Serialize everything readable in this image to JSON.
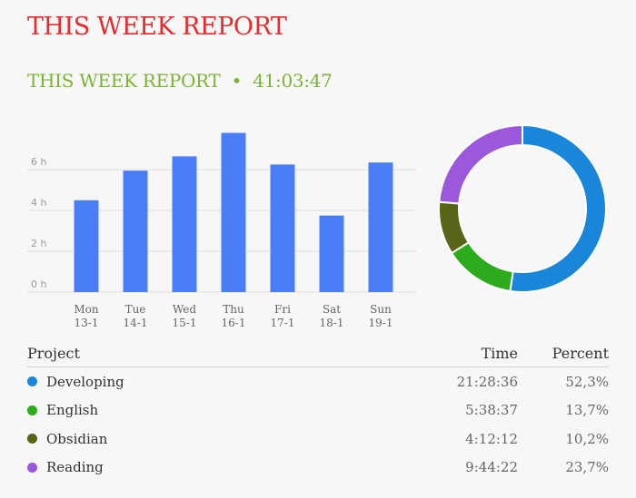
{
  "page_title": "THIS WEEK REPORT",
  "report": {
    "heading": "THIS WEEK REPORT",
    "separator": "•",
    "total": "41:03:47"
  },
  "colors": {
    "title": "#e52b2b",
    "heading": "#7ab335",
    "bar": "#4a7df7"
  },
  "chart_data": [
    {
      "type": "bar",
      "categories": [
        "Mon",
        "Tue",
        "Wed",
        "Thu",
        "Fri",
        "Sat",
        "Sun"
      ],
      "dates": [
        "13-1",
        "14-1",
        "15-1",
        "16-1",
        "17-1",
        "18-1",
        "19-1"
      ],
      "values": [
        4.5,
        5.95,
        6.65,
        7.8,
        6.25,
        3.75,
        6.35
      ],
      "yunit": "h",
      "yticks": [
        0,
        2,
        4,
        6
      ],
      "ylim": [
        0,
        8
      ],
      "grid": true
    },
    {
      "type": "pie",
      "donut": true,
      "labels": [
        "Developing",
        "English",
        "Obsidian",
        "Reading"
      ],
      "values": [
        52.3,
        13.7,
        10.2,
        23.7
      ],
      "colors": [
        "#1a86d9",
        "#2eaa1d",
        "#5a6419",
        "#9b58db"
      ]
    }
  ],
  "table": {
    "headers": {
      "project": "Project",
      "time": "Time",
      "percent": "Percent"
    },
    "rows": [
      {
        "project": "Developing",
        "time": "21:28:36",
        "percent": "52,3%",
        "color": "#1a86d9"
      },
      {
        "project": "English",
        "time": "5:38:37",
        "percent": "13,7%",
        "color": "#2eaa1d"
      },
      {
        "project": "Obsidian",
        "time": "4:12:12",
        "percent": "10,2%",
        "color": "#5a6419"
      },
      {
        "project": "Reading",
        "time": "9:44:22",
        "percent": "23,7%",
        "color": "#9b58db"
      }
    ]
  }
}
